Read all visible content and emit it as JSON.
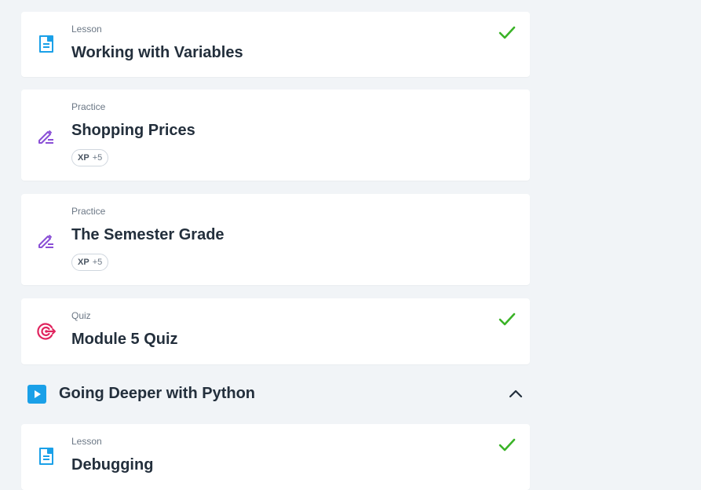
{
  "items_top": [
    {
      "type": "Lesson",
      "title": "Working with Variables",
      "completed": true,
      "icon": "lesson-icon"
    },
    {
      "type": "Practice",
      "title": "Shopping Prices",
      "completed": false,
      "icon": "pencil-icon",
      "xp_label": "XP",
      "xp_value": "+5"
    },
    {
      "type": "Practice",
      "title": "The Semester Grade",
      "completed": false,
      "icon": "pencil-icon",
      "xp_label": "XP",
      "xp_value": "+5"
    },
    {
      "type": "Quiz",
      "title": "Module 5 Quiz",
      "completed": true,
      "icon": "target-icon"
    }
  ],
  "section": {
    "title": "Going Deeper with Python",
    "expanded": true,
    "icon": "play-icon"
  },
  "items_section": [
    {
      "type": "Lesson",
      "title": "Debugging",
      "completed": true,
      "icon": "lesson-icon"
    }
  ],
  "colors": {
    "background": "#f1f4f7",
    "check": "#3ab327",
    "lesson_icon": "#1aa0e8",
    "practice_icon": "#8a4fd6",
    "quiz_icon": "#e0245e",
    "section_icon": "#1aa0e8"
  }
}
